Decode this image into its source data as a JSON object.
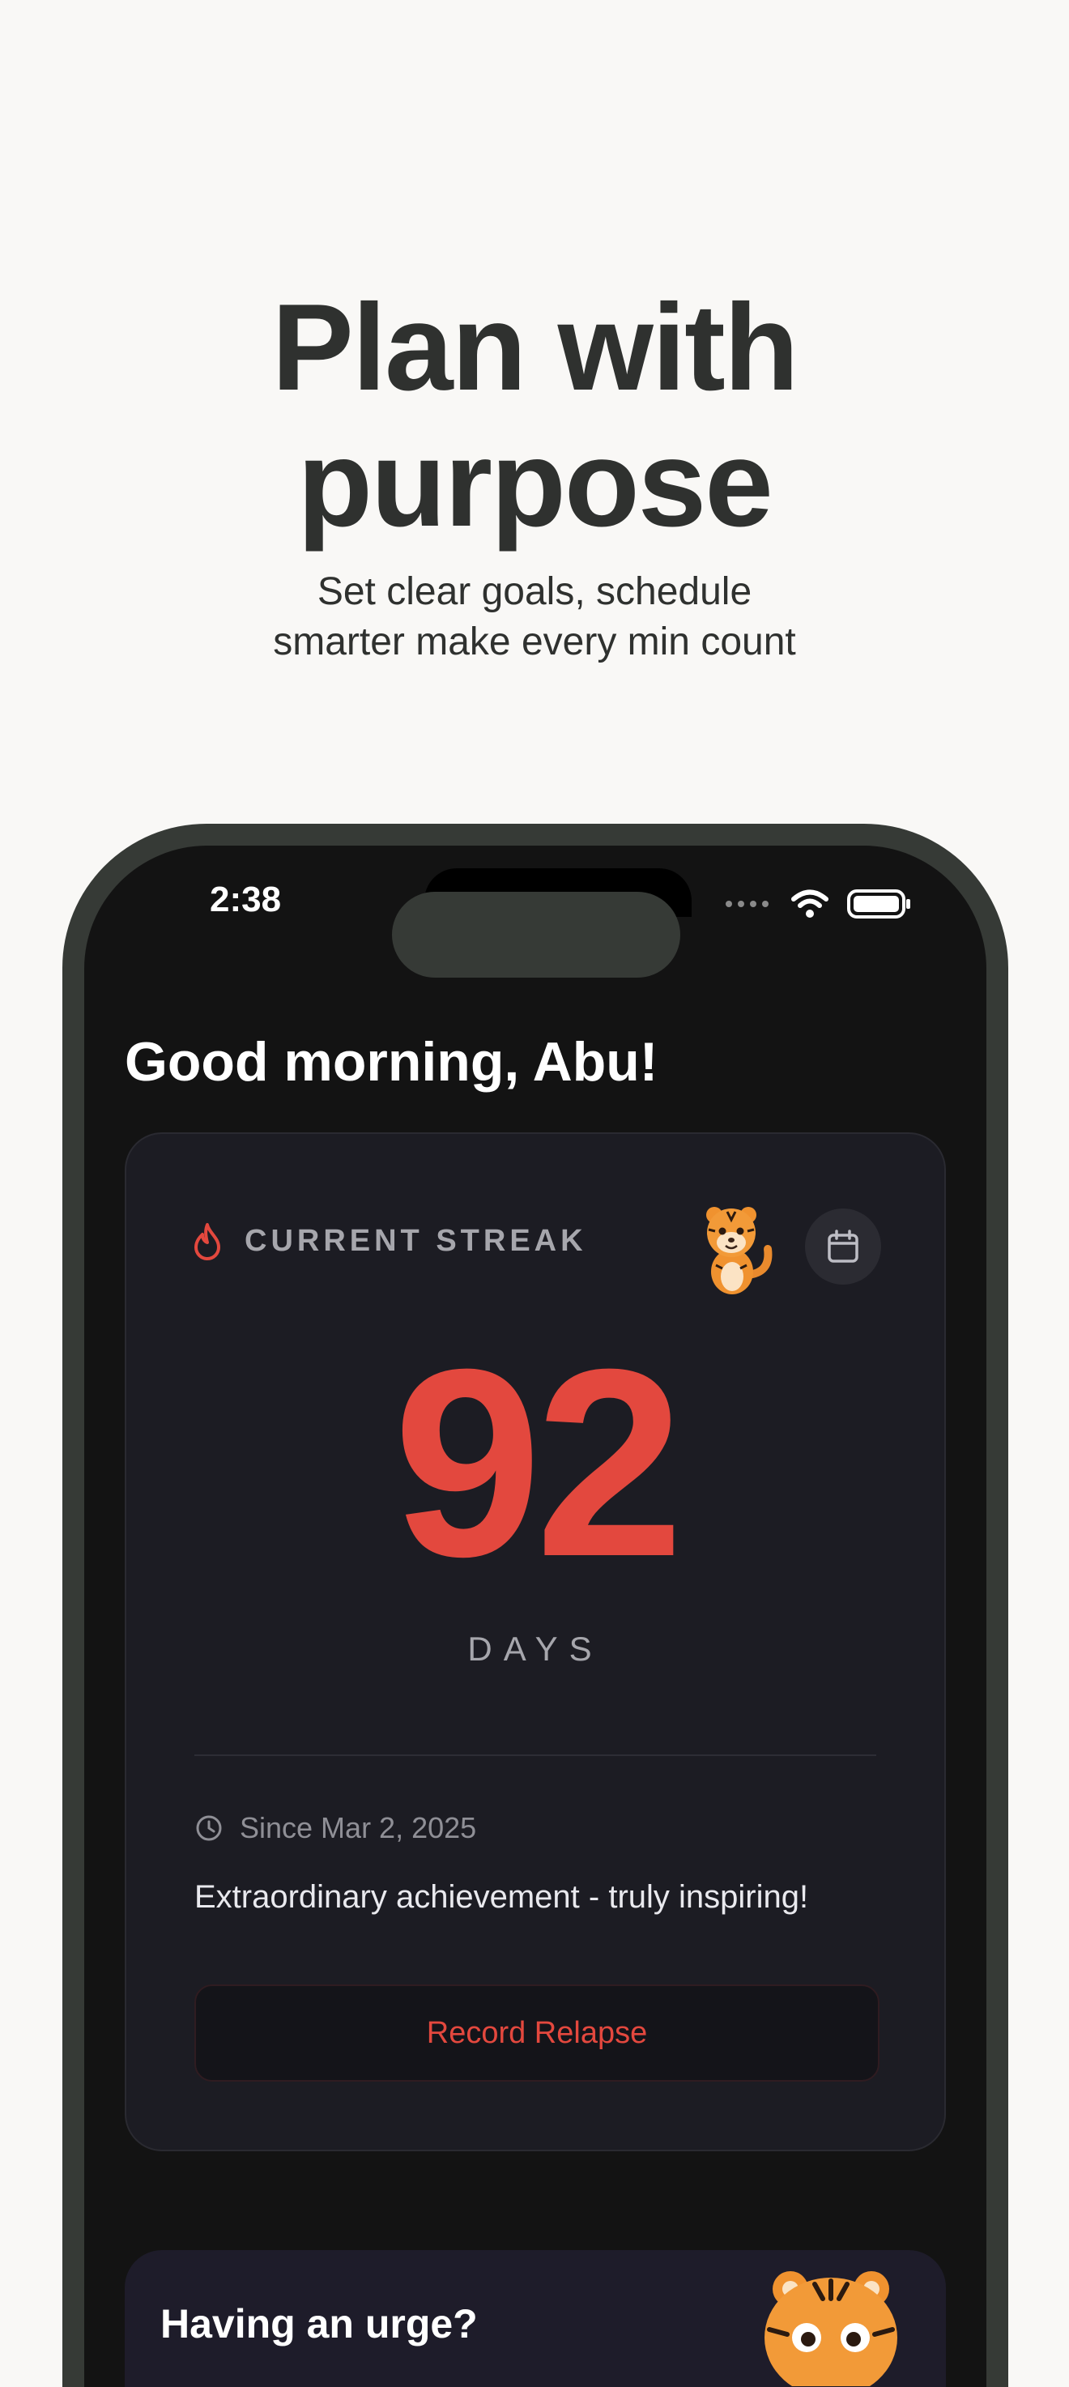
{
  "promo": {
    "headline_line1": "Plan with",
    "headline_line2": "purpose",
    "subline_line1": "Set clear goals, schedule",
    "subline_line2": "smarter make every min count"
  },
  "status_bar": {
    "time": "2:38",
    "icons": [
      "signal-dots-icon",
      "wifi-icon",
      "battery-icon"
    ]
  },
  "greeting": "Good morning, Abu!",
  "streak_card": {
    "label": "CURRENT STREAK",
    "label_icon": "flame-icon",
    "calendar_icon": "calendar-icon",
    "count": "92",
    "unit": "DAYS",
    "since": "Since Mar 2, 2025",
    "since_icon": "clock-icon",
    "message": "Extraordinary achievement - truly inspiring!",
    "relapse_button": "Record Relapse"
  },
  "urge_card": {
    "title": "Having an urge?"
  },
  "colors": {
    "accent": "#e3483e",
    "screen_bg": "#131313",
    "card_bg": "#1c1c23",
    "page_bg": "#f9f8f6",
    "frame": "#363a36"
  }
}
